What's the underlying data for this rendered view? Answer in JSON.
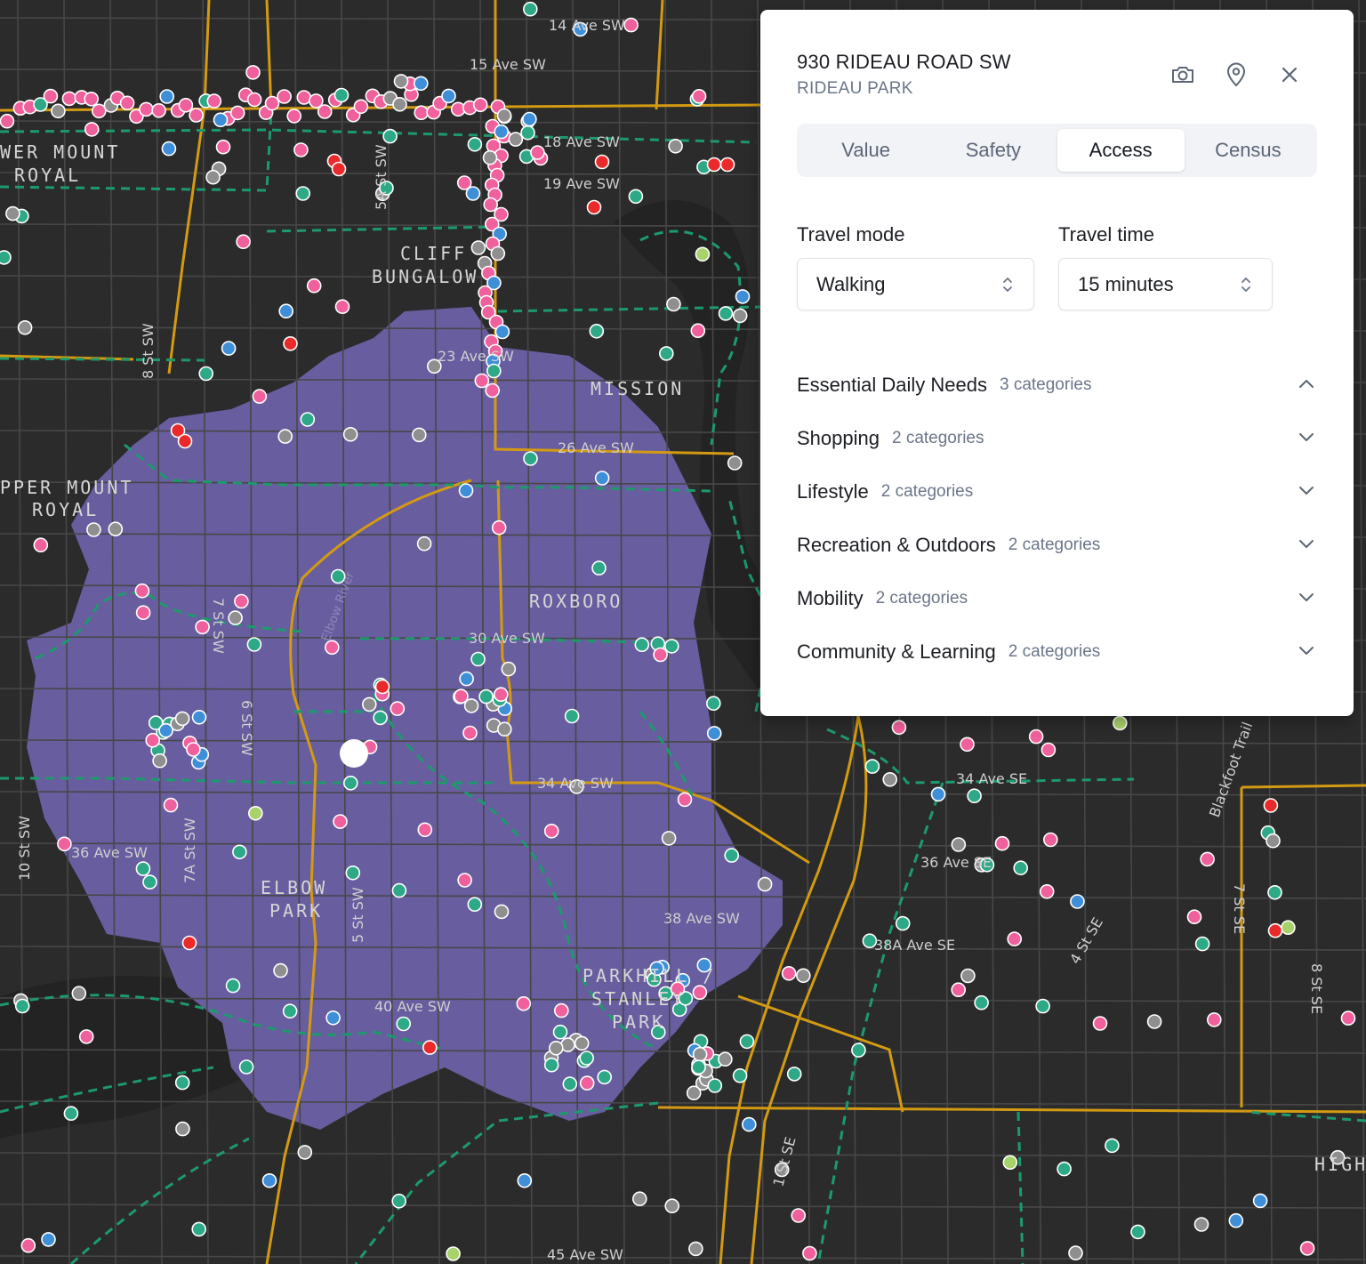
{
  "map": {
    "isochrone_color": "#6a5fa3",
    "poi_colors": {
      "essential": "#2ea987",
      "shopping": "#f0609c",
      "lifestyle": "#3f8fd8",
      "community": "#8f8f8f",
      "food": "#ea2a2a",
      "parks": "#a8d26a"
    },
    "area_labels": [
      "WER MOUNT",
      "ROYAL",
      "CLIFF",
      "BUNGALOW",
      "MISSION",
      "PPER MOUNT",
      "ROYAL",
      "ROXBORO",
      "ELBOW",
      "PARK",
      "PARKHILL /",
      "STANLEY",
      "PARK",
      "HIGH"
    ],
    "street_labels": [
      "14 Ave SW",
      "15 Ave SW",
      "18 Ave SW",
      "19 Ave SW",
      "23 Ave SW",
      "26 Ave SW",
      "30 Ave SW",
      "34 Ave SW",
      "36 Ave SW",
      "38 Ave SW",
      "40 Ave SW",
      "45 Ave SW",
      "34 Ave SE",
      "36 Ave SE",
      "38A Ave SE",
      "7 St SW",
      "6 St SW",
      "5A St SW",
      "5 St SW",
      "7A St SW",
      "8 St SW",
      "10 St SW",
      "4 St SE",
      "1 St SE",
      "7 St SE",
      "8 St SE",
      "Blackfoot Trail",
      "Elbow River"
    ]
  },
  "panel": {
    "address": "930 RIDEAU ROAD SW",
    "neighbourhood": "RIDEAU PARK",
    "tabs": [
      {
        "label": "Value",
        "active": false
      },
      {
        "label": "Safety",
        "active": false
      },
      {
        "label": "Access",
        "active": true
      },
      {
        "label": "Census",
        "active": false
      }
    ],
    "travel_mode": {
      "label": "Travel mode",
      "value": "Walking"
    },
    "travel_time": {
      "label": "Travel time",
      "value": "15 minutes"
    },
    "sections": [
      {
        "title": "Essential Daily Needs",
        "count": "3 categories",
        "expanded": true
      },
      {
        "title": "Shopping",
        "count": "2 categories",
        "expanded": false
      },
      {
        "title": "Lifestyle",
        "count": "2 categories",
        "expanded": false
      },
      {
        "title": "Recreation & Outdoors",
        "count": "2 categories",
        "expanded": false
      },
      {
        "title": "Mobility",
        "count": "2 categories",
        "expanded": false
      },
      {
        "title": "Community & Learning",
        "count": "2 categories",
        "expanded": false
      }
    ]
  }
}
